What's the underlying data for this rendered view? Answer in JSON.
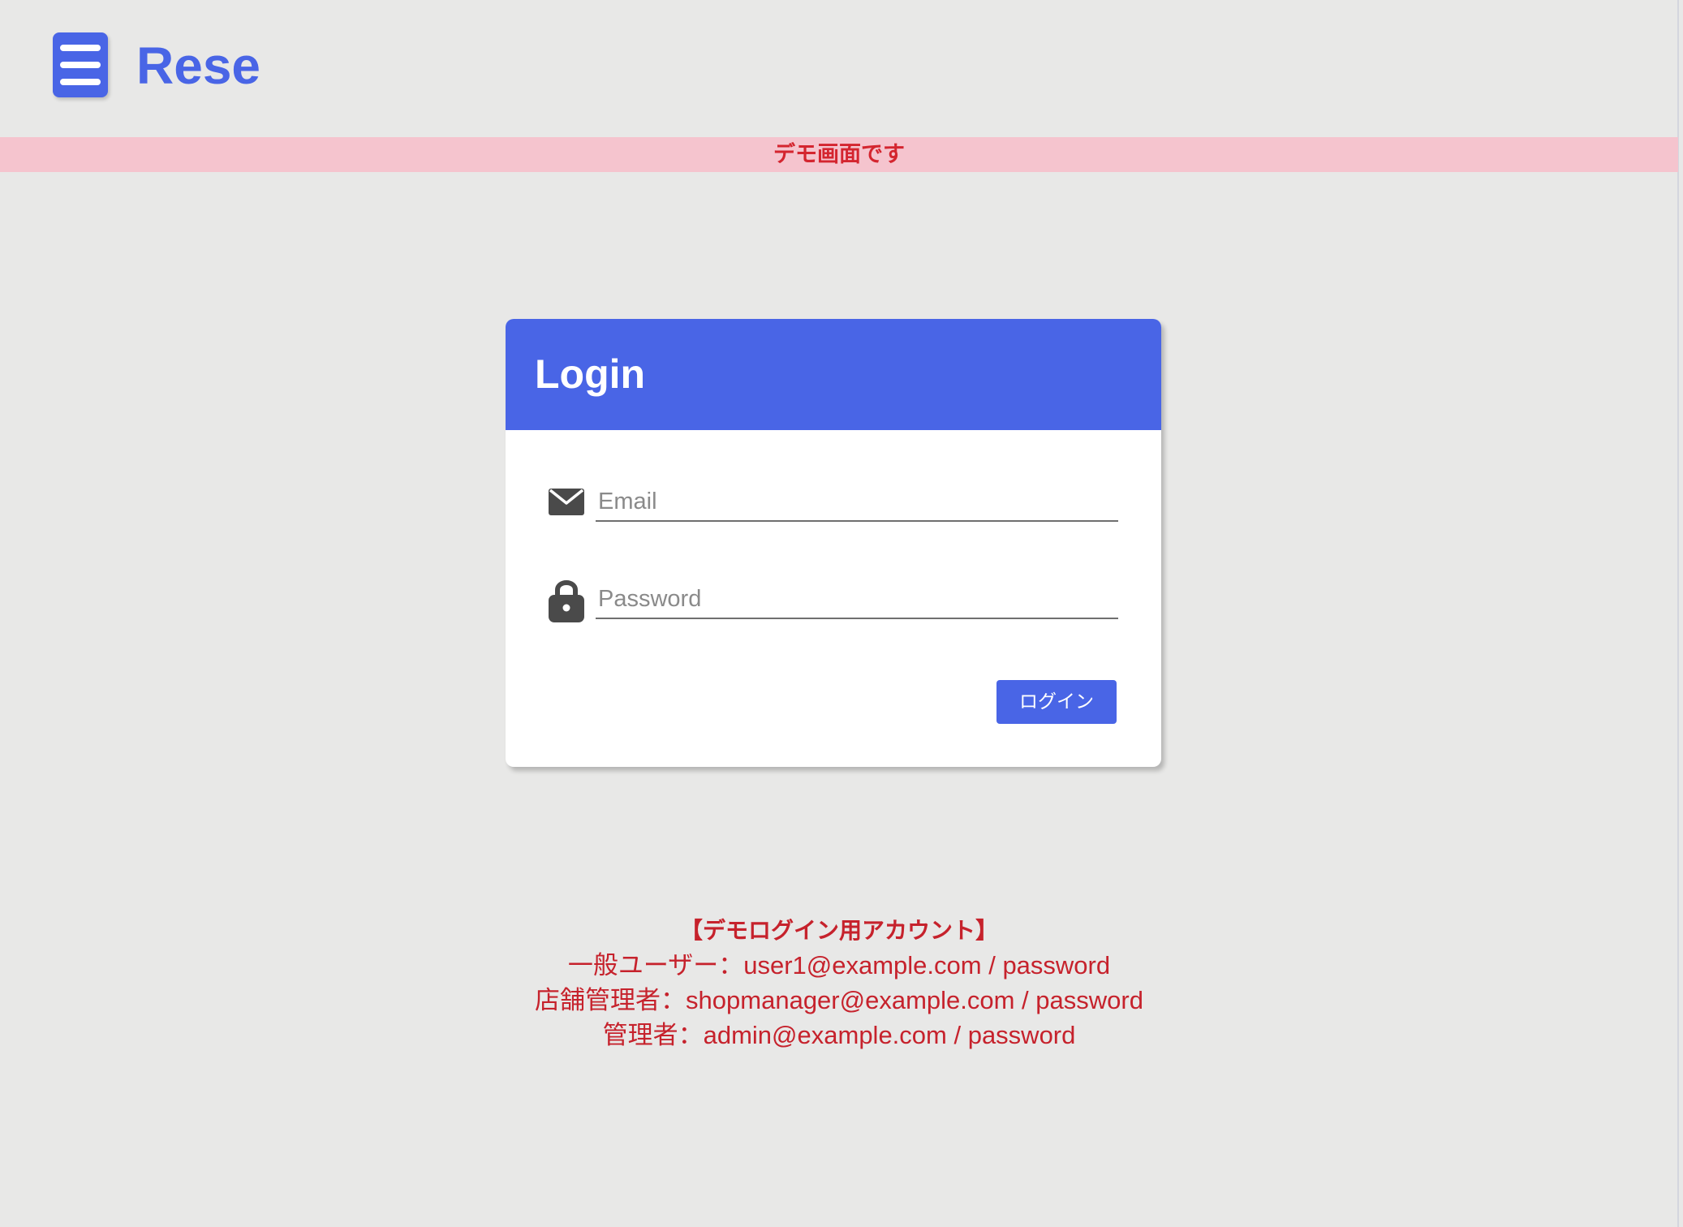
{
  "header": {
    "brand": "Rese",
    "menu_icon": "hamburger-menu-icon"
  },
  "banner": {
    "text": "デモ画面です"
  },
  "login": {
    "title": "Login",
    "email": {
      "icon": "envelope-icon",
      "placeholder": "Email",
      "value": ""
    },
    "password": {
      "icon": "lock-icon",
      "placeholder": "Password",
      "value": ""
    },
    "submit_label": "ログイン"
  },
  "demo_accounts": {
    "title": "【デモログイン用アカウント】",
    "lines": [
      "一般ユーザー：user1@example.com / password",
      "店舗管理者：shopmanager@example.com / password",
      "管理者：admin@example.com / password"
    ]
  },
  "colors": {
    "background": "#e8e8e7",
    "accent": "#4965e6",
    "banner_background": "#f5c4ce",
    "banner_text": "#d4252f",
    "demo_text": "#c6222c",
    "card_background": "#ffffff",
    "icon": "#4a4a4a"
  }
}
